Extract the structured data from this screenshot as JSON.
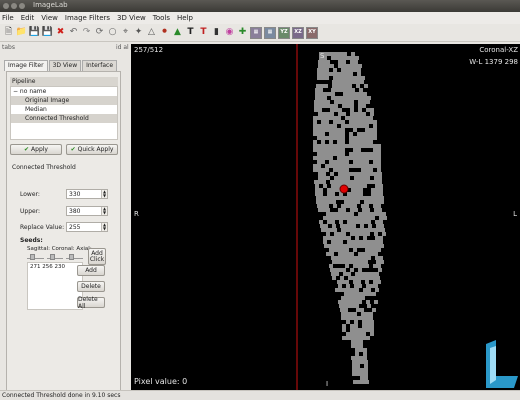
{
  "window": {
    "title": "ImageLab"
  },
  "menu": [
    "File",
    "Edit",
    "View",
    "Image Filters",
    "3D View",
    "Tools",
    "Help"
  ],
  "toolbar": {
    "icons": [
      "open-file-icon",
      "open-folder-icon",
      "save-icon",
      "save-as-icon",
      "close-icon",
      "undo-icon",
      "redo-icon",
      "rotate-icon",
      "flip-icon",
      "crop-icon",
      "draw-icon",
      "measure-icon",
      "pin-icon",
      "segment-icon",
      "text-icon",
      "annotation-icon",
      "paint-icon",
      "color-icon",
      "crosshair-icon",
      "fullscreen-icon",
      "zoom-icon"
    ],
    "view_buttons": [
      "YZ",
      "XZ",
      "XY"
    ]
  },
  "panel_header_left": "tabs",
  "panel_header_right": "id al",
  "tabs": [
    "Image Filter",
    "3D View",
    "Interface"
  ],
  "pipeline": {
    "header": "Pipeline",
    "items": [
      {
        "label": "− no name",
        "level": 0,
        "selected": false
      },
      {
        "label": "Original Image",
        "level": 1,
        "selected": true
      },
      {
        "label": "Median",
        "level": 1,
        "selected": false
      },
      {
        "label": "Connected Threshold",
        "level": 1,
        "selected": true
      }
    ]
  },
  "buttons": {
    "apply": "Apply",
    "quick_apply": "Quick Apply",
    "add_click": "Add Click",
    "add": "Add",
    "delete": "Delete",
    "delete_all": "Delete All"
  },
  "filter": {
    "title": "Connected Threshold",
    "lower_label": "Lower:",
    "lower_value": "330",
    "upper_label": "Upper:",
    "upper_value": "380",
    "replace_label": "Replace Value:",
    "replace_value": "255"
  },
  "seeds": {
    "label": "Seeds:",
    "columns": "Sagittal: Coronal: Axial:",
    "list": [
      "271 256 230"
    ]
  },
  "viewer": {
    "slice": "257/512",
    "view_name": "Coronal-XZ",
    "window_level": "W-L  1379 298",
    "pixel_value": "Pixel value: 0",
    "orient_top": "S",
    "orient_left": "R",
    "orient_right": "L",
    "orient_bottom": "I",
    "crosshair_color": "#cc1111",
    "seed_color": "#e00000"
  },
  "status": "Connected Threshold done in 9.10 secs"
}
